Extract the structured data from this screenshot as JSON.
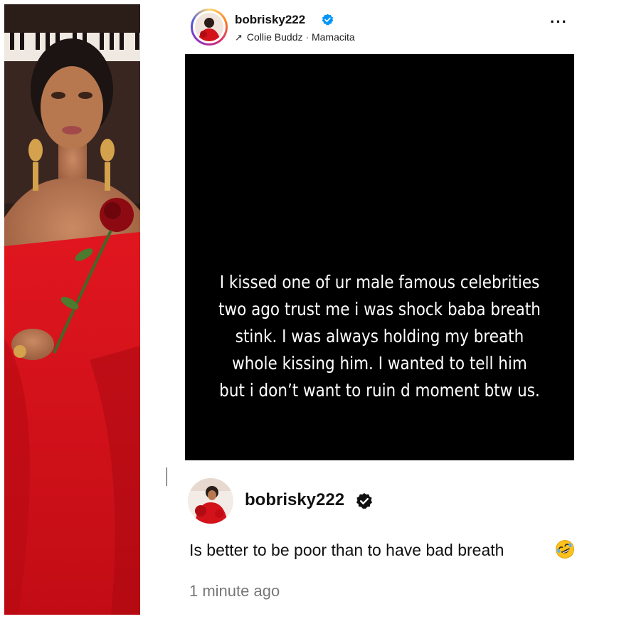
{
  "post": {
    "username": "bobrisky222",
    "music_artist": "Collie Buddz",
    "music_separator": "·",
    "music_title": "Mamacita",
    "music_arrow": "↗",
    "more_label": "···",
    "story_text": "I kissed one of ur male famous celebrities two ago trust me i was shock baba breath stink. I was always holding my breath whole kissing him. I wanted to tell him but i don’t want to ruin d moment btw us."
  },
  "comment": {
    "username": "bobrisky222",
    "text": "Is better to be poor than to have bad breath",
    "emoji": "rolling-on-floor-laughing-emoji",
    "time": "1 minute ago"
  },
  "colors": {
    "verified_blue": "#0095f6",
    "verified_black": "#111111",
    "story_bg": "#000000",
    "dress_red": "#d3121a"
  }
}
